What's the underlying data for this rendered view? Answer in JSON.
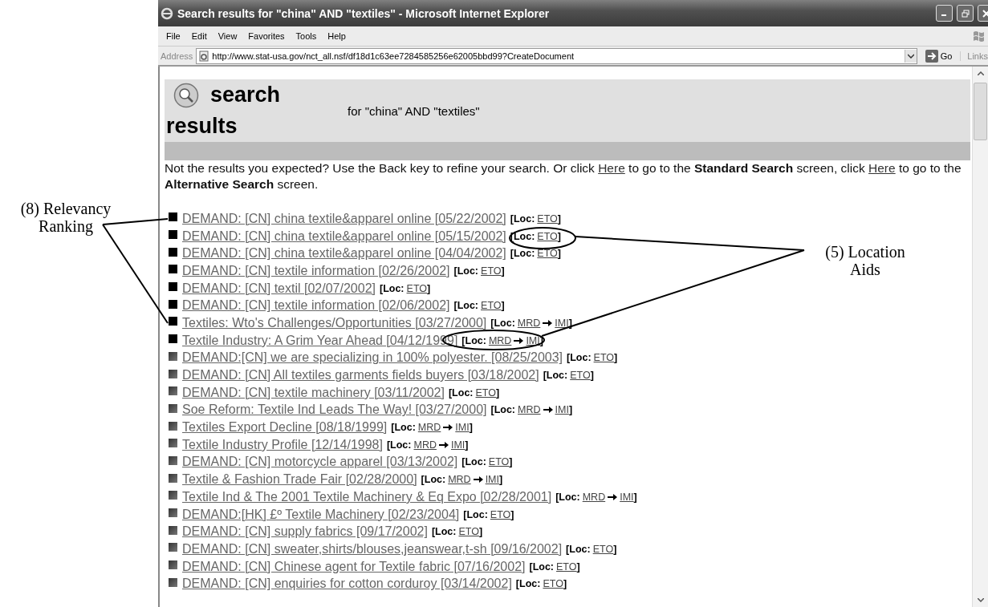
{
  "window": {
    "title": "Search results for \"china\" AND \"textiles\" - Microsoft Internet Explorer"
  },
  "menu": [
    "File",
    "Edit",
    "View",
    "Favorites",
    "Tools",
    "Help"
  ],
  "address_bar": {
    "label": "Address",
    "url": "http://www.stat-usa.gov/nct_all.nsf/df18d1c63ee7284585256e62005bbd99?CreateDocument",
    "go": "Go",
    "links": "Links"
  },
  "header": {
    "heading_lines": [
      "search",
      "results"
    ],
    "subtitle": "for \"china\" AND \"textiles\""
  },
  "notice": [
    {
      "kind": "text",
      "text": "Not the results you expected? Use the Back key to refine your search. Or click "
    },
    {
      "kind": "link",
      "text": "Here"
    },
    {
      "kind": "text",
      "text": " to go to the **Standard Search** screen, click "
    },
    {
      "kind": "link",
      "text": "Here"
    },
    {
      "kind": "text",
      "text": " to go to the **Alternative Search** screen."
    }
  ],
  "results": [
    {
      "title": "DEMAND: [CN] china textile&apparel online [05/22/2002]",
      "top_ranked": true,
      "loc_open": "[Loc:",
      "loc_links": [
        "ETO"
      ],
      "loc_close": "]"
    },
    {
      "title": "DEMAND: [CN] china textile&apparel online [05/15/2002]",
      "top_ranked": true,
      "loc_open": "[Loc:",
      "loc_links": [
        "ETO"
      ],
      "loc_close": "]"
    },
    {
      "title": "DEMAND: [CN] china textile&apparel online [04/04/2002]",
      "top_ranked": true,
      "loc_open": "[Loc:",
      "loc_links": [
        "ETO"
      ],
      "loc_close": "]"
    },
    {
      "title": "DEMAND: [CN] textile information [02/26/2002]",
      "top_ranked": true,
      "loc_open": "[Loc:",
      "loc_links": [
        "ETO"
      ],
      "loc_close": "]"
    },
    {
      "title": "DEMAND: [CN] textil [02/07/2002]",
      "top_ranked": true,
      "loc_open": "[Loc:",
      "loc_links": [
        "ETO"
      ],
      "loc_close": "]"
    },
    {
      "title": "DEMAND: [CN] textile information [02/06/2002]",
      "top_ranked": true,
      "loc_open": "[Loc:",
      "loc_links": [
        "ETO"
      ],
      "loc_close": "]"
    },
    {
      "title": "Textiles: Wto's Challenges/Opportunities [03/27/2000]",
      "top_ranked": true,
      "loc_open": "[Loc:",
      "loc_links": [
        "MRD",
        "IMI"
      ],
      "loc_close": "]"
    },
    {
      "title": "Textile Industry: A Grim Year Ahead [04/12/1999]",
      "top_ranked": true,
      "loc_open": "[Loc:",
      "loc_links": [
        "MRD",
        "IMI"
      ],
      "loc_close": "]"
    },
    {
      "title": "DEMAND:[CN] we are specializing in 100% polyester. [08/25/2003]",
      "top_ranked": false,
      "loc_open": "[Loc:",
      "loc_links": [
        "ETO"
      ],
      "loc_close": "]"
    },
    {
      "title": "DEMAND: [CN] All textiles garments fields buyers [03/18/2002]",
      "top_ranked": false,
      "loc_open": "[Loc:",
      "loc_links": [
        "ETO"
      ],
      "loc_close": "]"
    },
    {
      "title": "DEMAND: [CN] textile machinery [03/11/2002]",
      "top_ranked": false,
      "loc_open": "[Loc:",
      "loc_links": [
        "ETO"
      ],
      "loc_close": "]"
    },
    {
      "title": "Soe Reform: Textile Ind Leads The Way! [03/27/2000]",
      "top_ranked": false,
      "loc_open": "[Loc:",
      "loc_links": [
        "MRD",
        "IMI"
      ],
      "loc_close": "]"
    },
    {
      "title": "Textiles Export Decline [08/18/1999]",
      "top_ranked": false,
      "loc_open": "[Loc:",
      "loc_links": [
        "MRD",
        "IMI"
      ],
      "loc_close": "]"
    },
    {
      "title": "Textile Industry Profile [12/14/1998]",
      "top_ranked": false,
      "loc_open": "[Loc:",
      "loc_links": [
        "MRD",
        "IMI"
      ],
      "loc_close": "]"
    },
    {
      "title": "DEMAND: [CN] motorcycle apparel [03/13/2002]",
      "top_ranked": false,
      "loc_open": "[Loc:",
      "loc_links": [
        "ETO"
      ],
      "loc_close": "]"
    },
    {
      "title": "Textile & Fashion Trade Fair [02/28/2000]",
      "top_ranked": false,
      "loc_open": "[Loc:",
      "loc_links": [
        "MRD",
        "IMI"
      ],
      "loc_close": "]"
    },
    {
      "title": "Textile Ind & The 2001 Textile Machinery & Eq Expo [02/28/2001]",
      "top_ranked": false,
      "loc_open": "[Loc:",
      "loc_links": [
        "MRD",
        "IMI"
      ],
      "loc_close": "]"
    },
    {
      "title": "DEMAND:[HK] £º Textile Machinery [02/23/2004]",
      "top_ranked": false,
      "loc_open": "[Loc:",
      "loc_links": [
        "ETO"
      ],
      "loc_close": "]"
    },
    {
      "title": "DEMAND: [CN] supply fabrics [09/17/2002]",
      "top_ranked": false,
      "loc_open": "[Loc:",
      "loc_links": [
        "ETO"
      ],
      "loc_close": "]"
    },
    {
      "title": "DEMAND: [CN] sweater,shirts/blouses,jeanswear,t-sh [09/16/2002]",
      "top_ranked": false,
      "loc_open": "[Loc:",
      "loc_links": [
        "ETO"
      ],
      "loc_close": "]"
    },
    {
      "title": "DEMAND: [CN] Chinese agent for Textile fabric [07/16/2002]",
      "top_ranked": false,
      "loc_open": "[Loc:",
      "loc_links": [
        "ETO"
      ],
      "loc_close": "]"
    },
    {
      "title": "DEMAND: [CN] enquiries for cotton corduroy [03/14/2002]",
      "top_ranked": false,
      "loc_open": "[Loc:",
      "loc_links": [
        "ETO"
      ],
      "loc_close": "]"
    }
  ],
  "annotations": [
    {
      "text": "(8) Relevancy Ranking"
    },
    {
      "text": "(5) Location Aids"
    }
  ]
}
